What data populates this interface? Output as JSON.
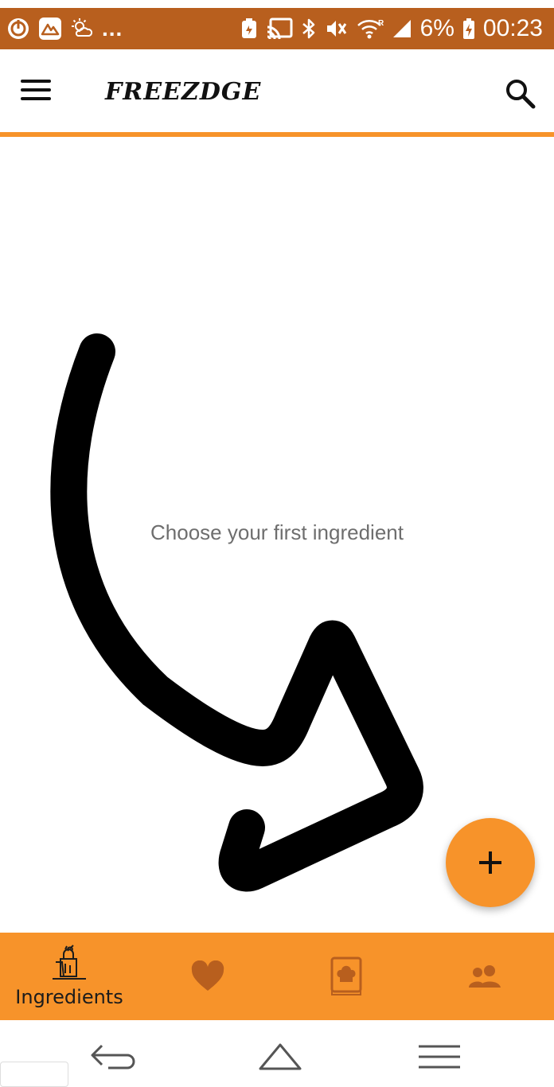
{
  "status_bar": {
    "battery_percent": "6%",
    "time": "00:23",
    "more_indicator": "...",
    "background_color": "#b85f1e",
    "icons_left": [
      "power-icon",
      "mountain-app-icon",
      "weather-icon"
    ],
    "icons_right": [
      "battery-saver-icon",
      "cast-icon",
      "bluetooth-icon",
      "mute-icon",
      "wifi-icon",
      "signal-icon",
      "charging-icon"
    ]
  },
  "app_bar": {
    "title": "FREEZDGE",
    "menu_icon": "menu-icon",
    "search_icon": "search-icon",
    "accent_color": "#f7932a"
  },
  "main": {
    "empty_message": "Choose your first ingredient",
    "hint_arrow_icon": "curved-arrow-icon"
  },
  "fab": {
    "label": "+",
    "color": "#f7932a",
    "icon": "plus-icon"
  },
  "bottom_nav": {
    "background_color": "#f7932a",
    "items": [
      {
        "label": "Ingredients",
        "icon": "grocery-bag-icon",
        "active": true
      },
      {
        "icon": "heart-icon",
        "active": false
      },
      {
        "icon": "recipe-book-icon",
        "active": false
      },
      {
        "icon": "people-icon",
        "active": false
      }
    ]
  },
  "system_nav": {
    "icons": [
      "back-icon",
      "home-icon",
      "recents-icon"
    ]
  }
}
